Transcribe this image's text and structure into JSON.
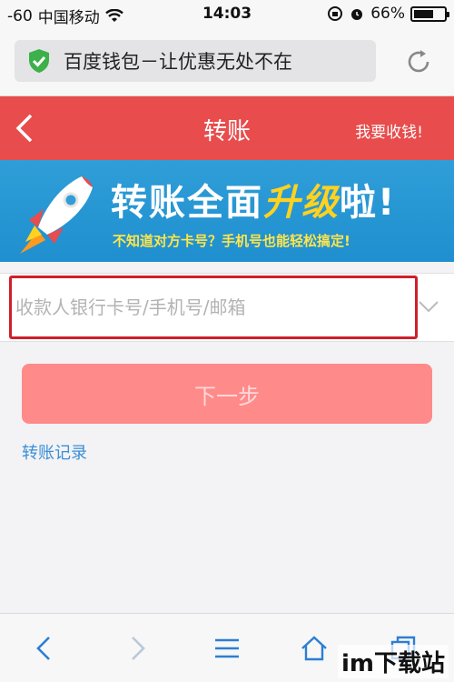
{
  "status_bar": {
    "signal": "-60",
    "carrier": "中国移动",
    "time": "14:03",
    "battery": "66%",
    "battery_level": 0.66
  },
  "browser": {
    "url_title": "百度钱包－让优惠无处不在",
    "reload_icon": "reload-icon"
  },
  "header": {
    "title": "转账",
    "receive_label": "我要收钱!",
    "background": "#e84c4c"
  },
  "banner": {
    "headline_part1": "转账全面",
    "headline_accent": "升级",
    "headline_part2": "啦!",
    "subtitle": "不知道对方卡号？手机号也能轻松搞定!"
  },
  "form": {
    "recipient_placeholder": "收款人银行卡号/手机号/邮箱",
    "recipient_value": "",
    "next_label": "下一步",
    "record_link": "转账记录"
  },
  "colors": {
    "accent": "#e84c4c",
    "highlight_border": "#d01f2a",
    "button": "#ff8a8a",
    "link": "#3a8fd6",
    "banner": "#2f9ed8"
  },
  "watermark": "im下载站"
}
